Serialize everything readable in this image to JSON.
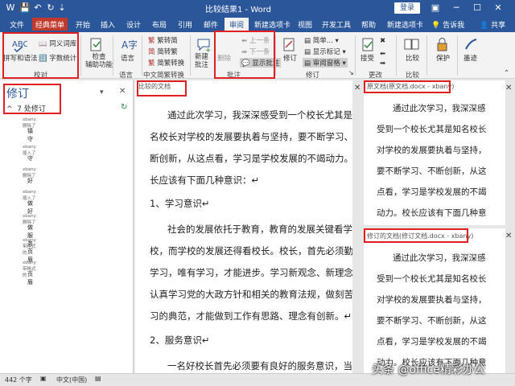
{
  "titlebar": {
    "title": "比较结果1 - Word",
    "login": "登录",
    "bg": "#2b579a"
  },
  "tabs": [
    "文件",
    "经典菜单",
    "开始",
    "插入",
    "设计",
    "布局",
    "引用",
    "邮件",
    "审阅",
    "新建选项卡",
    "视图",
    "开发工具",
    "帮助",
    "新建选项卡",
    "告诉我",
    "共享"
  ],
  "ribbon": {
    "proofing": {
      "spelling": "拼写和语法",
      "thesaurus": "同义词库",
      "wordcount": "字数统计",
      "label": "校对"
    },
    "accessibility": {
      "check": "检查\n辅助功能",
      "label": "辅助功能"
    },
    "language": {
      "btn": "语言",
      "label": "语言"
    },
    "chinese": {
      "t2s": "繁转简",
      "s2t": "简转繁",
      "convert": "简繁转换",
      "label": "中文简繁转换"
    },
    "comments": {
      "new": "新建\n批注",
      "delete": "删除",
      "prev": "上一条",
      "next": "下一条",
      "show": "显示批注",
      "label": "批注"
    },
    "tracking": {
      "track": "修订",
      "simple": "简单...",
      "markup": "显示标记",
      "pane": "审阅窗格",
      "label": "修订"
    },
    "changes": {
      "accept": "接受",
      "label": "更改"
    },
    "compare": {
      "btn": "比较",
      "label": "比较"
    },
    "protect": {
      "btn": "保护"
    },
    "ink": {
      "btn": "墨迹"
    }
  },
  "revisions": {
    "title": "修订",
    "count": "7 处修订",
    "items": [
      {
        "author": "xbany 删除了",
        "text": "镇守"
      },
      {
        "author": "xbany 插入了",
        "text": "守"
      },
      {
        "author": "xbany 删除了",
        "text": "好"
      },
      {
        "author": "xbany 插入了",
        "text": "做好"
      },
      {
        "author": "xbany 删除了",
        "text": "做服务"
      },
      {
        "author": "xbany 带格式的",
        "text": "页眉"
      },
      {
        "author": "xbany 带格式的",
        "text": "页眉"
      }
    ]
  },
  "compared": {
    "header": "比较的文档",
    "paragraphs": [
      "通过此次学习，我深深感受到一个校长尤其是知",
      "名校长对学校的发展要执着与坚持，要不断学习、不",
      "断创新，从这点看，学习是学校发展的不竭动力。校",
      "长应该有下面几种意识：↵",
      "1、学习意识↵",
      "社会的发展依托于教育，教育的发展关键看学",
      "校，而学校的发展还得看校长。校长，首先必须勤于",
      "学习，唯有学习，才能进步。学习新观念、新理念、",
      "认真学习党的大政方针和相关的教育法规，做刻苦学",
      "习的典范，才能做到工作有思路、理念有创新。↵",
      "2、服务意识↵",
      "一名好校长首先必须要有良好的服务意识，当好"
    ]
  },
  "original": {
    "header": "原文档(原文档.docx - xbany)",
    "paragraphs": [
      "通过此次学习，我深深感",
      "受到一个校长尤其是知名校长",
      "对学校的发展要执着与坚持，",
      "要不断学习、不断创新，从这",
      "点看，学习是学校发展的不竭",
      "动力。校长应该有下面几种意"
    ]
  },
  "revised": {
    "header": "修订的文档(修订文档.docx - xbany)",
    "paragraphs": [
      "通过此次学习，我深深感",
      "受到一个校长尤其是知名校长",
      "对学校的发展要执着与坚持，",
      "要不断学习、不断创新，从这",
      "点看，学习是学校发展的不竭",
      "动力。校长应该有下面几种意"
    ]
  },
  "status": {
    "words": "442 个字",
    "lang": "中文(中国)"
  },
  "watermark": "头条 @office精彩办公"
}
